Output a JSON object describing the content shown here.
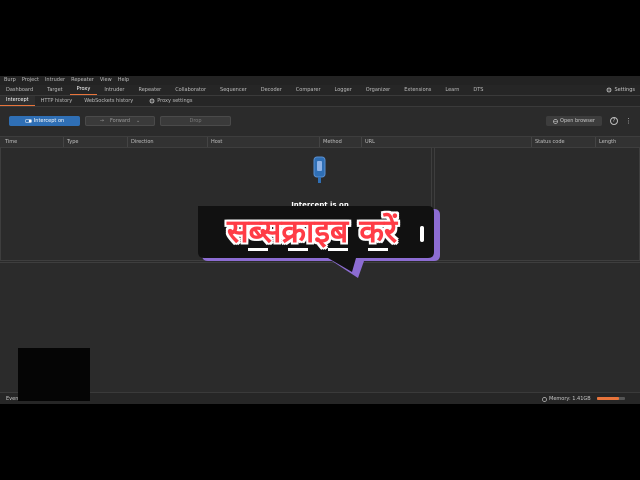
{
  "menubar": {
    "items": [
      "Burp",
      "Project",
      "Intruder",
      "Repeater",
      "View",
      "Help"
    ]
  },
  "tabs": {
    "items": [
      "Dashboard",
      "Target",
      "Proxy",
      "Intruder",
      "Repeater",
      "Collaborator",
      "Sequencer",
      "Decoder",
      "Comparer",
      "Logger",
      "Organizer",
      "Extensions",
      "Learn",
      "DTS"
    ],
    "active": "Proxy",
    "settings_label": "Settings"
  },
  "subtabs": {
    "items": [
      "Intercept",
      "HTTP history",
      "WebSockets history"
    ],
    "active": "Intercept",
    "proxy_settings_label": "Proxy settings"
  },
  "toolbar": {
    "intercept_label": "Intercept on",
    "forward_label": "Forward",
    "drop_label": "Drop",
    "open_browser_label": "Open browser"
  },
  "table": {
    "columns": [
      "Time",
      "Type",
      "Direction",
      "Host",
      "Method",
      "URL",
      "Status code",
      "Length"
    ]
  },
  "intercept_message": "Intercept is on",
  "overlay": {
    "subscribe_text": "सब्सक्राइब करें"
  },
  "status_bar": {
    "left_text": "Even",
    "memory_label": "Memory: 1.41GB",
    "memory_fraction": 0.8
  },
  "colors": {
    "accent": "#e8743b",
    "primary_button": "#2f6fb5",
    "subscribe_red": "#ff3c46",
    "subscribe_purple": "#8c6cd2"
  }
}
